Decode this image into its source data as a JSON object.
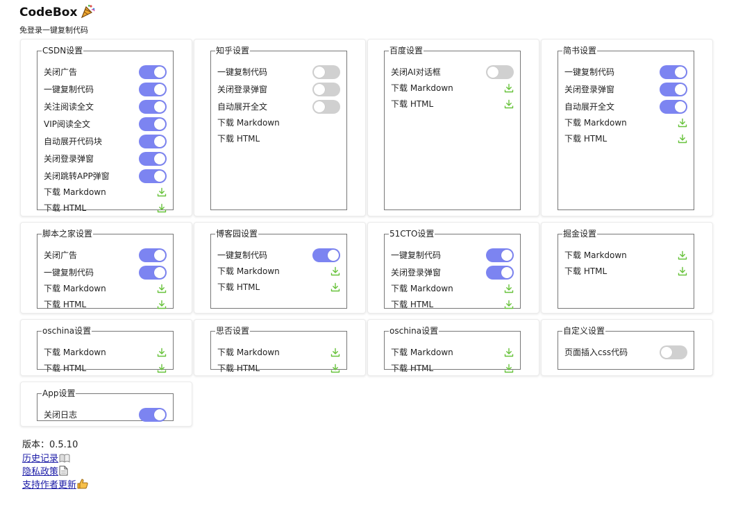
{
  "header": {
    "title": "CodeBox",
    "logo_icon": "party-popper-icon",
    "subtitle": "免登录一键复制代码"
  },
  "colors": {
    "accent": "#7c84f1",
    "toggle_off": "#d0d0d0",
    "download_icon": "#67c23a",
    "link": "#1a1aa6"
  },
  "cards": [
    {
      "id": "csdn",
      "title": "CSDN设置",
      "rows": [
        {
          "label": "关闭广告",
          "control": "toggle",
          "on": true
        },
        {
          "label": "一键复制代码",
          "control": "toggle",
          "on": true
        },
        {
          "label": "关注阅读全文",
          "control": "toggle",
          "on": true
        },
        {
          "label": "VIP阅读全文",
          "control": "toggle",
          "on": true
        },
        {
          "label": "自动展开代码块",
          "control": "toggle",
          "on": true
        },
        {
          "label": "关闭登录弹窗",
          "control": "toggle",
          "on": true
        },
        {
          "label": "关闭跳转APP弹窗",
          "control": "toggle",
          "on": true
        },
        {
          "label": "下载 Markdown",
          "control": "download"
        },
        {
          "label": "下载 HTML",
          "control": "download"
        }
      ]
    },
    {
      "id": "zhihu",
      "title": "知乎设置",
      "rows": [
        {
          "label": "一键复制代码",
          "control": "toggle",
          "on": false
        },
        {
          "label": "关闭登录弹窗",
          "control": "toggle",
          "on": false
        },
        {
          "label": "自动展开全文",
          "control": "toggle",
          "on": false
        },
        {
          "label": "下载 Markdown",
          "control": "none"
        },
        {
          "label": "下载 HTML",
          "control": "none"
        }
      ]
    },
    {
      "id": "baidu",
      "title": "百度设置",
      "rows": [
        {
          "label": "关闭AI对话框",
          "control": "toggle",
          "on": false
        },
        {
          "label": "下载 Markdown",
          "control": "download"
        },
        {
          "label": "下载 HTML",
          "control": "download"
        }
      ]
    },
    {
      "id": "jianshu",
      "title": "简书设置",
      "rows": [
        {
          "label": "一键复制代码",
          "control": "toggle",
          "on": true
        },
        {
          "label": "关闭登录弹窗",
          "control": "toggle",
          "on": true
        },
        {
          "label": "自动展开全文",
          "control": "toggle",
          "on": true
        },
        {
          "label": "下载 Markdown",
          "control": "download"
        },
        {
          "label": "下载 HTML",
          "control": "download"
        }
      ]
    },
    {
      "id": "jb51",
      "title": "脚本之家设置",
      "rows": [
        {
          "label": "关闭广告",
          "control": "toggle",
          "on": true
        },
        {
          "label": "一键复制代码",
          "control": "toggle",
          "on": true
        },
        {
          "label": "下载 Markdown",
          "control": "download"
        },
        {
          "label": "下载 HTML",
          "control": "download"
        }
      ]
    },
    {
      "id": "cnblogs",
      "title": "博客园设置",
      "rows": [
        {
          "label": "一键复制代码",
          "control": "toggle",
          "on": true
        },
        {
          "label": "下载 Markdown",
          "control": "download"
        },
        {
          "label": "下载 HTML",
          "control": "download"
        }
      ]
    },
    {
      "id": "51cto",
      "title": "51CTO设置",
      "rows": [
        {
          "label": "一键复制代码",
          "control": "toggle",
          "on": true
        },
        {
          "label": "关闭登录弹窗",
          "control": "toggle",
          "on": true
        },
        {
          "label": "下载 Markdown",
          "control": "download"
        },
        {
          "label": "下载 HTML",
          "control": "download"
        }
      ]
    },
    {
      "id": "juejin",
      "title": "掘金设置",
      "rows": [
        {
          "label": "下载 Markdown",
          "control": "download"
        },
        {
          "label": "下载 HTML",
          "control": "download"
        }
      ]
    },
    {
      "id": "oschina",
      "title": "oschina设置",
      "rows": [
        {
          "label": "下载 Markdown",
          "control": "download"
        },
        {
          "label": "下载 HTML",
          "control": "download"
        }
      ]
    },
    {
      "id": "sifou",
      "title": "思否设置",
      "rows": [
        {
          "label": "下载 Markdown",
          "control": "download"
        },
        {
          "label": "下载 HTML",
          "control": "download"
        }
      ]
    },
    {
      "id": "oschina2",
      "title": "oschina设置",
      "rows": [
        {
          "label": "下载 Markdown",
          "control": "download"
        },
        {
          "label": "下载 HTML",
          "control": "download"
        }
      ]
    },
    {
      "id": "custom",
      "title": "自定义设置",
      "rows": [
        {
          "label": "页面插入css代码",
          "control": "toggle",
          "on": false
        }
      ]
    },
    {
      "id": "app",
      "title": "App设置",
      "rows": [
        {
          "label": "关闭日志",
          "control": "toggle",
          "on": true
        }
      ]
    }
  ],
  "footer": {
    "version": "版本：0.5.10",
    "links": [
      {
        "label": "历史记录",
        "icon": "open-book-icon"
      },
      {
        "label": "隐私政策",
        "icon": "document-icon"
      },
      {
        "label": "支持作者更新",
        "icon": "thumbs-up-icon"
      }
    ]
  }
}
